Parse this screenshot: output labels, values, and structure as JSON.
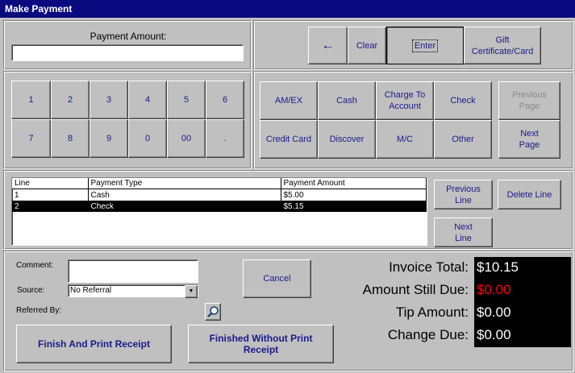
{
  "window": {
    "title": "Make Payment"
  },
  "payment_amount": {
    "label": "Payment Amount:",
    "value": ""
  },
  "top_buttons": {
    "back_symbol": "←",
    "clear": "Clear",
    "enter": "Enter",
    "gift": "Gift Certificate/Card"
  },
  "keypad": [
    "1",
    "2",
    "3",
    "4",
    "5",
    "6",
    "7",
    "8",
    "9",
    "0",
    "00",
    "."
  ],
  "payment_types": {
    "amex": "AM/EX",
    "cash": "Cash",
    "charge": "Charge To Account",
    "check": "Check",
    "previous_page": "Previous Page",
    "credit_card": "Credit Card",
    "discover": "Discover",
    "mc": "M/C",
    "other": "Other",
    "next_page": "Next Page"
  },
  "lines_table": {
    "headers": [
      "Line",
      "Payment Type",
      "Payment Amount"
    ],
    "rows": [
      [
        "1",
        "Cash",
        "$5.00"
      ],
      [
        "2",
        "Check",
        "$5.15"
      ]
    ]
  },
  "line_buttons": {
    "previous": "Previous Line",
    "next": "Next Line",
    "delete": "Delete Line"
  },
  "form": {
    "comment_label": "Comment:",
    "comment_value": "",
    "source_label": "Source:",
    "source_value": "No Referral",
    "referred_label": "Referred By:"
  },
  "actions": {
    "cancel": "Cancel",
    "finish_print": "Finish And Print Receipt",
    "finish_no_print": "Finished Without Print Receipt"
  },
  "totals": {
    "invoice_label": "Invoice Total:",
    "invoice_value": "$10.15",
    "due_label": "Amount Still Due:",
    "due_value": "$0.00",
    "tip_label": "Tip Amount:",
    "tip_value": "$0.00",
    "change_label": "Change Due:",
    "change_value": "$0.00"
  },
  "colors": {
    "title_bar": "#0a0a80",
    "button_text": "#1a1a8c",
    "due_red": "#ff0000"
  }
}
